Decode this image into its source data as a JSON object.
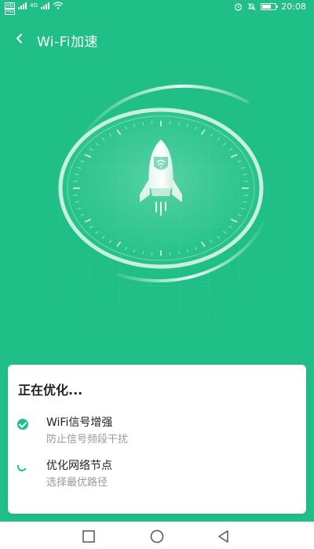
{
  "status_bar": {
    "sim1_label": "HD",
    "sim2_label": "HD",
    "network_type": "4G",
    "time": "20:08",
    "icons": [
      "alarm-icon",
      "mute-icon",
      "battery-icon"
    ]
  },
  "header": {
    "title": "Wi-Fi加速",
    "back_icon": "chevron-left-icon"
  },
  "hero": {
    "icon": "rocket-icon",
    "badge_icon": "wifi-shield-icon"
  },
  "progress_sheet": {
    "title": "正在优化...",
    "tasks": [
      {
        "title": "WiFi信号增强",
        "subtitle": "防止信号频段干扰",
        "status": "done"
      },
      {
        "title": "优化网络节点",
        "subtitle": "选择最优路径",
        "status": "in-progress"
      }
    ]
  },
  "nav_bar": {
    "buttons": [
      "recent-apps-icon",
      "home-icon",
      "back-triangle-icon"
    ]
  },
  "colors": {
    "background": "#1fbf87",
    "accent": "#1fbf87",
    "sheet": "#ffffff"
  }
}
